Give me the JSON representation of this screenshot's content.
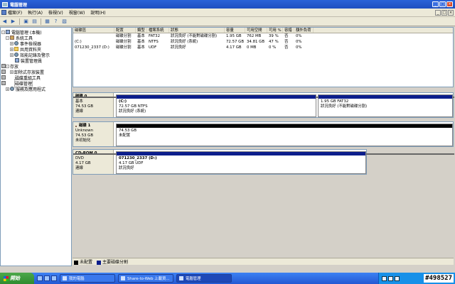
{
  "window": {
    "title": "電腦管理",
    "buttons": [
      "_",
      "□",
      "×"
    ]
  },
  "menubar": {
    "items": [
      "檔案(F)",
      "執行(A)",
      "檢視(V)",
      "視窗(W)",
      "說明(H)"
    ],
    "mdi_buttons": [
      "_",
      "□",
      "×"
    ]
  },
  "toolbar": {
    "icons": [
      "back-icon",
      "forward-icon",
      "up-icon",
      "show-hide-tree-icon",
      "export-icon",
      "help-icon",
      "properties-icon"
    ]
  },
  "tree": {
    "items": [
      {
        "label": "電腦管理 (本機)",
        "icon": "computer-icon",
        "level": 0,
        "expander": "-"
      },
      {
        "label": "系統工具",
        "icon": "tools-icon",
        "level": 1,
        "expander": "-"
      },
      {
        "label": "事件檢視器",
        "icon": "event-viewer-icon",
        "level": 2,
        "expander": "+"
      },
      {
        "label": "共用資料夾",
        "icon": "shared-folder-icon",
        "level": 2,
        "expander": "+"
      },
      {
        "label": "效能記錄及警示",
        "icon": "performance-icon",
        "level": 2,
        "expander": "+"
      },
      {
        "label": "裝置管理員",
        "icon": "device-manager-icon",
        "level": 2,
        "expander": ""
      },
      {
        "label": "存放",
        "icon": "storage-icon",
        "level": 1,
        "expander": "-"
      },
      {
        "label": "卸除式存放裝置",
        "icon": "removable-storage-icon",
        "level": 2,
        "expander": "+"
      },
      {
        "label": "磁碟重組工具",
        "icon": "defrag-icon",
        "level": 2,
        "expander": ""
      },
      {
        "label": "磁碟管理",
        "icon": "disk-management-icon",
        "level": 2,
        "expander": ""
      },
      {
        "label": "服務及應用程式",
        "icon": "services-icon",
        "level": 1,
        "expander": "+"
      }
    ]
  },
  "volumes": {
    "headers": [
      "磁碟區",
      "配置",
      "類型",
      "檔案系統",
      "狀態",
      "容量",
      "可用空間",
      "可用 %",
      "容錯",
      "額外負荷"
    ],
    "rows": [
      [
        "",
        "磁碟分割",
        "基本",
        "FAT32",
        "狀況良好 (不能對磁碟分割)",
        "1.95 GB",
        "762 MB",
        "39 %",
        "否",
        "0%"
      ],
      [
        "(C:)",
        "磁碟分割",
        "基本",
        "NTFS",
        "狀況良好 (系統)",
        "72.57 GB",
        "34.81 GB",
        "47 %",
        "否",
        "0%"
      ],
      [
        "071230_2337 (D:)",
        "磁碟分割",
        "基本",
        "UDF",
        "狀況良好",
        "4.17 GB",
        "0 MB",
        "0 %",
        "否",
        "0%"
      ]
    ]
  },
  "disks": [
    {
      "name": "磁碟 0",
      "type": "基本",
      "size": "74.53 GB",
      "status": "連線",
      "icon": "disk-icon",
      "partitions": [
        {
          "title": "(C:)",
          "line1": "72.57 GB NTFS",
          "line2": "狀況良好 (系統)",
          "bar": "primary"
        },
        {
          "title": "",
          "line1": "1.95 GB FAT32",
          "line2": "狀況良好 (不能對磁碟分割)",
          "bar": "primary"
        }
      ]
    },
    {
      "name": "磁碟 1",
      "type": "Unknown",
      "size": "74.53 GB",
      "status": "未初始化",
      "icon": "disk-error-icon",
      "partitions": [
        {
          "title": "",
          "line1": "74.53 GB",
          "line2": "未配置",
          "bar": "unallocated"
        }
      ]
    },
    {
      "name": "CD-ROM 0",
      "type": "DVD",
      "size": "4.17 GB",
      "status": "連線",
      "icon": "cdrom-icon",
      "partitions": [
        {
          "title": "071230_2337 (D:)",
          "line1": "4.17 GB UDF",
          "line2": "狀況良好",
          "bar": "primary"
        }
      ]
    }
  ],
  "legend": [
    {
      "label": "未配置",
      "color": "#000000"
    },
    {
      "label": "主要磁碟分割",
      "color": "#0c1e8c"
    }
  ],
  "taskbar": {
    "start_label": "開始",
    "tasks": [
      "我的電腦",
      "Share-to-Web 上載資...",
      "電腦管理"
    ],
    "active_task": "電腦管理",
    "stamp": "#498527"
  }
}
